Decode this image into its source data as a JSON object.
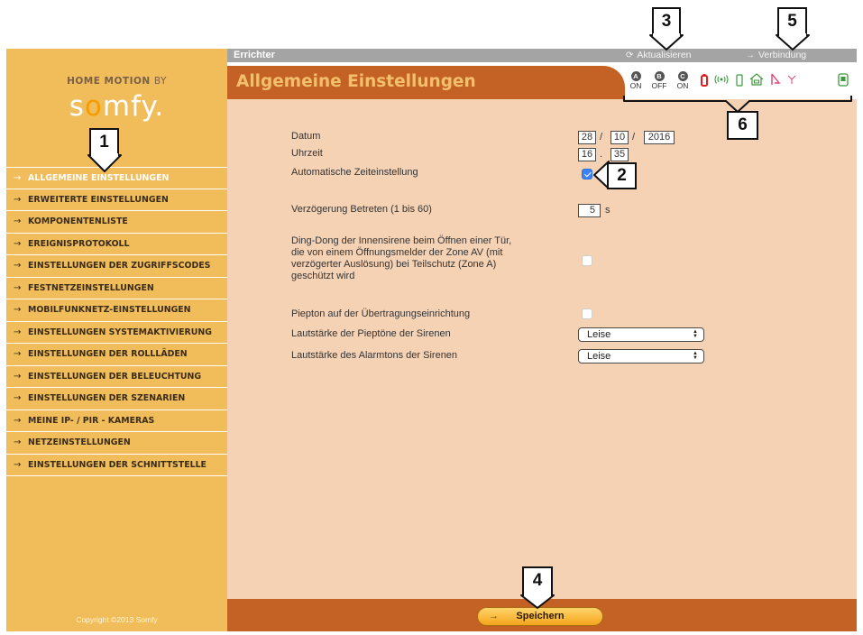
{
  "brand": {
    "line": "HOME MOTION",
    "by": "BY",
    "logo": "somfy"
  },
  "copyright": "Copyright ©2013 Somfy",
  "sidebar": {
    "items": [
      {
        "label": "ALLGEMEINE EINSTELLUNGEN",
        "active": true
      },
      {
        "label": "ERWEITERTE EINSTELLUNGEN"
      },
      {
        "label": "KOMPONENTENLISTE"
      },
      {
        "label": "EREIGNISPROTOKOLL"
      },
      {
        "label": "EINSTELLUNGEN DER ZUGRIFFSCODES"
      },
      {
        "label": "FESTNETZEINSTELLUNGEN"
      },
      {
        "label": "MOBILFUNKNETZ-EINSTELLUNGEN"
      },
      {
        "label": "EINSTELLUNGEN SYSTEMAKTIVIERUNG"
      },
      {
        "label": "EINSTELLUNGEN DER ROLLLÄDEN"
      },
      {
        "label": "EINSTELLUNGEN DER BELEUCHTUNG"
      },
      {
        "label": "EINSTELLUNGEN DER SZENARIEN"
      },
      {
        "label": "MEINE IP- / PIR - KAMERAS"
      },
      {
        "label": "NETZEINSTELLUNGEN"
      },
      {
        "label": "EINSTELLUNGEN DER SCHNITTSTELLE"
      }
    ]
  },
  "topbar": {
    "role": "Errichter",
    "update": "Aktualisieren",
    "connect": "Verbindung"
  },
  "page_title": "Allgemeine Einstellungen",
  "status": {
    "modes": [
      {
        "letter": "A",
        "state": "ON"
      },
      {
        "letter": "B",
        "state": "OFF"
      },
      {
        "letter": "C",
        "state": "ON"
      }
    ]
  },
  "form": {
    "date_label": "Datum",
    "date_day": "28",
    "date_month": "10",
    "date_year": "2016",
    "date_sep": "/",
    "time_label": "Uhrzeit",
    "time_hour": "16",
    "time_minute": "35",
    "time_sep": ".",
    "auto_time_label": "Automatische Zeiteinstellung",
    "auto_time_checked": true,
    "entry_delay_label": "Verzögerung Betreten (1 bis 60)",
    "entry_delay_value": "5",
    "entry_delay_unit": "s",
    "dingdong_label_1": "Ding-Dong der Innensirene beim Öffnen einer Tür,",
    "dingdong_label_2": "die von einem Öffnungsmelder der Zone AV (mit",
    "dingdong_label_3": "verzögerter Auslösung) bei Teilschutz (Zone A)",
    "dingdong_label_4": "geschützt wird",
    "dingdong_checked": false,
    "beep_label": "Piepton auf der Übertragungseinrichtung",
    "beep_checked": false,
    "beep_volume_label": "Lautstärke der Pieptöne der Sirenen",
    "beep_volume_value": "Leise",
    "alarm_volume_label": "Lautstärke des Alarmtons der Sirenen",
    "alarm_volume_value": "Leise"
  },
  "footer": {
    "save_label": "Speichern"
  },
  "callouts": [
    "1",
    "2",
    "3",
    "4",
    "5",
    "6"
  ],
  "colors": {
    "sidebar_bg": "#f1bd5a",
    "accent": "#c46124",
    "content_bg": "#f6d2b5",
    "title_text": "#f2c06c",
    "topbar": "#a4a4a4"
  }
}
